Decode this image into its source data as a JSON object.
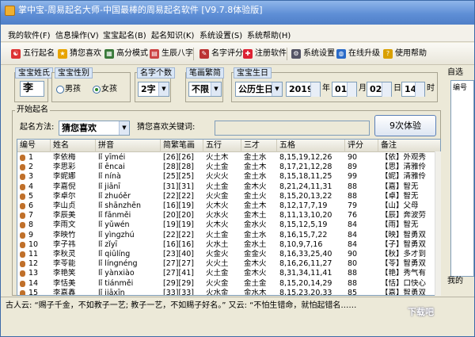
{
  "window": {
    "title": "掌中宝-周易起名大师-中国最棒的周易起名软件 [V9.7.8体验版]"
  },
  "menu": [
    "我的软件(F)",
    "信息操作(V)",
    "宝宝起名(B)",
    "起名知识(K)",
    "系统设置(S)",
    "系统帮助(H)"
  ],
  "toolbar": [
    {
      "label": "五行起名",
      "icon": "bagua-icon",
      "color": "#d33"
    },
    {
      "label": "猜您喜欢",
      "icon": "star-icon",
      "color": "#e8a400"
    },
    {
      "label": "高分模式",
      "icon": "grid-icon",
      "color": "#3a7a3a"
    },
    {
      "label": "生辰八字",
      "icon": "calendar-icon",
      "color": "#c44"
    },
    {
      "label": "名字评分",
      "icon": "score-icon",
      "color": "#b33"
    },
    {
      "label": "注册软件",
      "icon": "register-icon",
      "color": "#d23"
    },
    {
      "label": "系统设置",
      "icon": "settings-icon",
      "color": "#556"
    },
    {
      "label": "在线升级",
      "icon": "globe-icon",
      "color": "#2a6bc8"
    },
    {
      "label": "使用帮助",
      "icon": "help-bulb-icon",
      "color": "#d9a000"
    }
  ],
  "form": {
    "surname_label": "宝宝姓氏",
    "surname_value": "李",
    "gender_label": "宝宝性别",
    "gender_male": "男孩",
    "gender_female": "女孩",
    "count_label": "名字个数",
    "count_value": "2字",
    "script_label": "笔画繁简",
    "script_value": "不限",
    "birthday_label": "宝宝生日",
    "calendar_value": "公历生日",
    "year": "2019",
    "year_unit": "年",
    "month": "01",
    "month_unit": "月",
    "day": "02",
    "day_unit": "日",
    "hour": "14",
    "hour_unit": "时",
    "start_label": "开始起名",
    "method_label": "起名方法:",
    "method_value": "猜您喜欢",
    "keyword_label": "猜您喜欢关键词:",
    "keyword_value": "",
    "trial_button": "9次体验"
  },
  "right_panel": {
    "top_label": "自选",
    "tab_label": "编号",
    "bottom_label": "我的"
  },
  "table": {
    "columns": [
      "编号",
      "姓名",
      "拼音",
      "简繁笔画",
      "五行",
      "三才",
      "五格",
      "评分",
      "备注"
    ],
    "rows": [
      [
        "1",
        "李依梅",
        "lǐ yīméi",
        "[26][26]",
        "火土木",
        "金土水",
        "8,15,19,12,26",
        "90",
        "【依】外观秀"
      ],
      [
        "2",
        "李思彩",
        "lǐ ēncai",
        "[28][28]",
        "火土金",
        "金土木",
        "8,17,21,12,28",
        "89",
        "【思】清雅伶"
      ],
      [
        "3",
        "李妮娜",
        "lǐ nínà",
        "[25][25]",
        "火火火",
        "金土水",
        "8,15,18,11,25",
        "99",
        "【妮】清雅伶"
      ],
      [
        "4",
        "李嘉倪",
        "lǐ jiānī",
        "[31][31]",
        "火土金",
        "金木火",
        "8,21,24,11,31",
        "88",
        "【嘉】智无"
      ],
      [
        "5",
        "李卓尔",
        "lǐ zhuóěr",
        "[22][22]",
        "火火金",
        "金土火",
        "8,15,20,13,22",
        "88",
        "【卓】智无"
      ],
      [
        "6",
        "李山贞",
        "lǐ shānzhēn",
        "[16][19]",
        "火木火",
        "金土木",
        "8,12,17,7,19",
        "79",
        "【山】父母"
      ],
      [
        "7",
        "李辰美",
        "lǐ fānměi",
        "[20][20]",
        "火水火",
        "金木土",
        "8,11,13,10,20",
        "76",
        "【辰】奔波劳"
      ],
      [
        "8",
        "李雨文",
        "lǐ yǔwén",
        "[19][19]",
        "火木火",
        "金水火",
        "8,15,12,5,19",
        "84",
        "【雨】智无"
      ],
      [
        "9",
        "李映竹",
        "lǐ yìngzhú",
        "[22][22]",
        "火土金",
        "金土水",
        "8,16,15,7,22",
        "84",
        "【映】智勇双"
      ],
      [
        "10",
        "李子祎",
        "lǐ zǐyī",
        "[16][16]",
        "火水土",
        "金水土",
        "8,10,9,7,16",
        "84",
        "【子】智勇双"
      ],
      [
        "11",
        "李秋灵",
        "lǐ qiūlíng",
        "[23][40]",
        "火金火",
        "金金火",
        "8,16,33,25,40",
        "90",
        "【秋】多才到"
      ],
      [
        "12",
        "李苓能",
        "lǐ língnéng",
        "[27][27]",
        "火火土",
        "金木火",
        "8,16,26,11,27",
        "80",
        "【苓】智勇双"
      ],
      [
        "13",
        "李艳笑",
        "lǐ yànxiào",
        "[27][41]",
        "火土金",
        "金木火",
        "8,31,34,11,41",
        "88",
        "【艳】秀气有"
      ],
      [
        "14",
        "李恬美",
        "lǐ tiánměi",
        "[29][29]",
        "火火金",
        "金土金",
        "8,15,20,14,29",
        "88",
        "【恬】口快心"
      ],
      [
        "15",
        "李嘉鑫",
        "lǐ jiāxīn",
        "[33][33]",
        "火水金",
        "金水木",
        "8,15,23,20,33",
        "85",
        "【嘉】智勇双"
      ]
    ]
  },
  "status": {
    "text": "古人云: “赐子千金，不如教子一艺; 教子一艺，不如赐子好名。” 又云: “不怕生错命，就怕起错名……",
    "download_label": "下载吧"
  }
}
